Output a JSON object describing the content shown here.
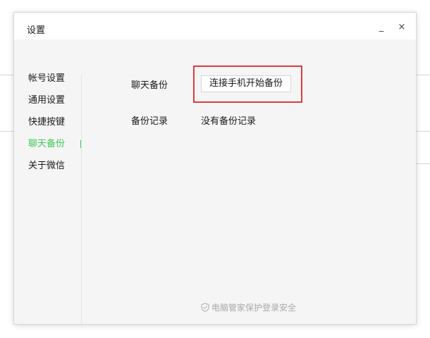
{
  "window": {
    "title": "设置",
    "minimize_glyph": "_",
    "close_glyph": "×"
  },
  "sidebar": {
    "items": [
      {
        "label": "帐号设置",
        "active": false
      },
      {
        "label": "通用设置",
        "active": false
      },
      {
        "label": "快捷按键",
        "active": false
      },
      {
        "label": "聊天备份",
        "active": true
      },
      {
        "label": "关于微信",
        "active": false
      }
    ]
  },
  "main": {
    "chat_backup_label": "聊天备份",
    "backup_button_label": "连接手机开始备份",
    "backup_record_label": "备份记录",
    "backup_record_value": "没有备份记录"
  },
  "footer": {
    "text": "电脑管家保护登录安全",
    "icon": "shield-icon"
  },
  "colors": {
    "accent": "#3fc85a",
    "highlight": "#e0393b"
  }
}
